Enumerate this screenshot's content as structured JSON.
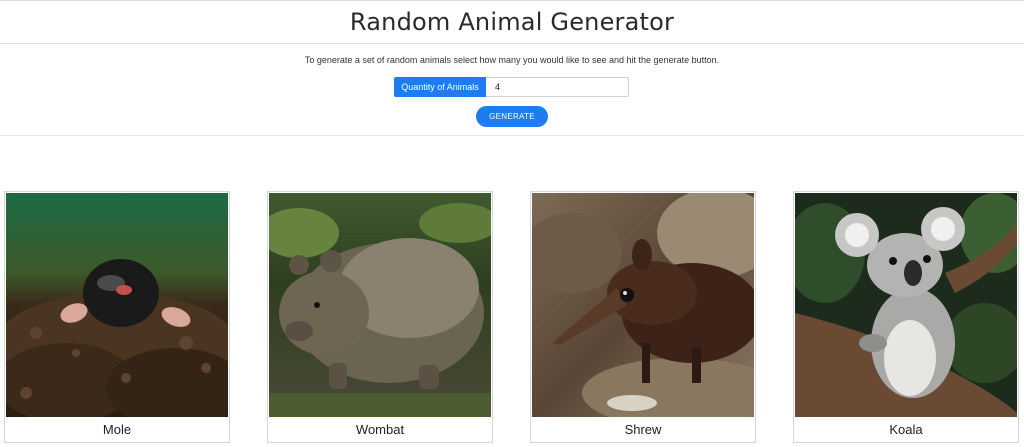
{
  "header": {
    "title": "Random Animal Generator"
  },
  "controls": {
    "instructions": "To generate a set of random animals select how many you would like to see and hit the generate button.",
    "quantity_label": "Quantity of Animals",
    "quantity_value": "4",
    "generate_label": "GENERATE"
  },
  "animals": [
    {
      "name": "Mole",
      "icon": "mole-photo"
    },
    {
      "name": "Wombat",
      "icon": "wombat-photo"
    },
    {
      "name": "Shrew",
      "icon": "shrew-photo"
    },
    {
      "name": "Koala",
      "icon": "koala-photo"
    }
  ],
  "colors": {
    "accent": "#1f7bf0"
  }
}
